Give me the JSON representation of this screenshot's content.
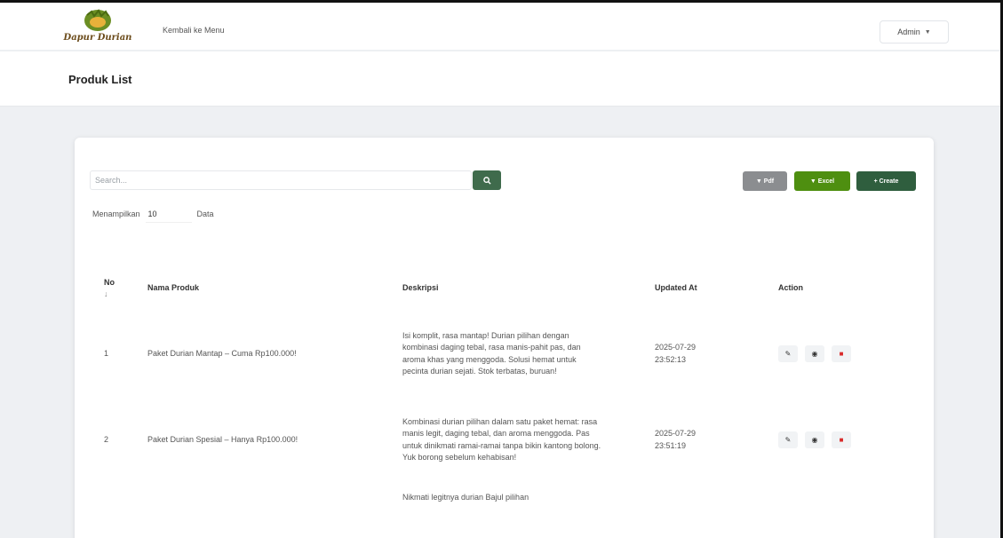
{
  "nav": {
    "logo_text": "Dapur Durian",
    "back_link": "Kembali ke Menu",
    "user": "Admin"
  },
  "header": {
    "title": "Produk List"
  },
  "toolbar": {
    "search_placeholder": "Search...",
    "show_label": "Menampilkan",
    "show_count": "10",
    "show_suffix": "Data",
    "pdf_label": "▼ Pdf",
    "excel_label": "▼ Excel",
    "create_label": "+ Create"
  },
  "table": {
    "headers": {
      "no": "No",
      "sort": "↓",
      "name": "Nama Produk",
      "desc": "Deskripsi",
      "updated": "Updated At",
      "action": "Action"
    },
    "rows": [
      {
        "no": "1",
        "name": "Paket Durian Mantap – Cuma Rp100.000!",
        "desc": "Isi komplit, rasa mantap! Durian pilihan dengan kombinasi daging tebal, rasa manis-pahit pas, dan aroma khas yang menggoda. Solusi hemat untuk pecinta durian sejati. Stok terbatas, buruan!",
        "date": "2025-07-29",
        "time": "23:52:13"
      },
      {
        "no": "2",
        "name": "Paket Durian Spesial – Hanya Rp100.000!",
        "desc": "Kombinasi durian pilihan dalam satu paket hemat: rasa manis legit, daging tebal, dan aroma menggoda. Pas untuk dinikmati ramai-ramai tanpa bikin kantong bolong. Yuk borong sebelum kehabisan!",
        "date": "2025-07-29",
        "time": "23:51:19"
      },
      {
        "no": "",
        "name": "",
        "desc": "Nikmati legitnya durian Bajul pilihan",
        "date": "",
        "time": ""
      }
    ]
  },
  "colors": {
    "primary": "#3f6b4c",
    "excel": "#4e8f10",
    "create": "#2f5e3e",
    "pdf": "#8b8d90",
    "danger": "#d92a2a"
  },
  "icons": {
    "search": "search-icon",
    "edit": "pencil-icon",
    "view": "eye-icon",
    "delete": "trash-icon"
  }
}
